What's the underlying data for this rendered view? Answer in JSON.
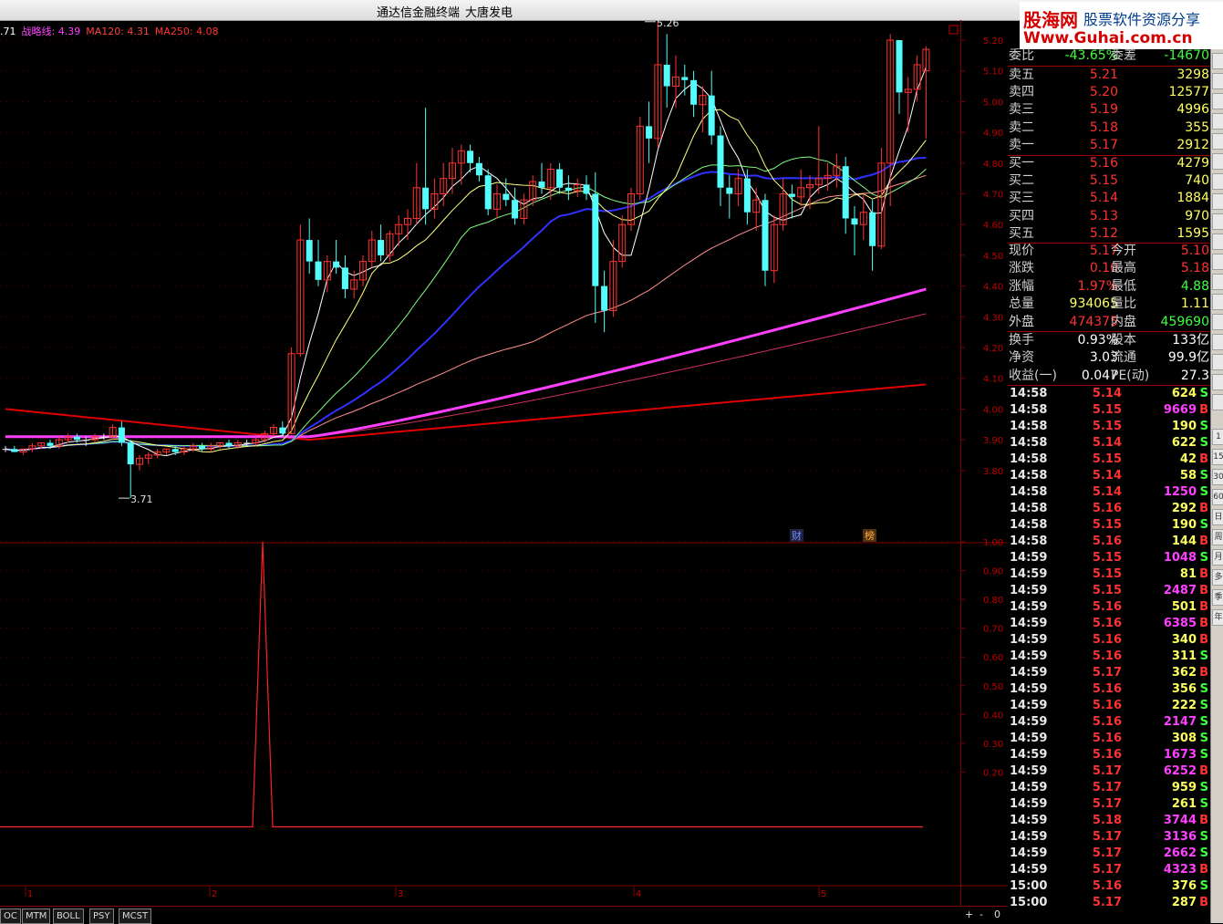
{
  "window": {
    "app_title": "通达信金融终端",
    "stock_name": "大唐发电"
  },
  "logo": {
    "line1": "股海网",
    "line2": "股票软件资源分享",
    "line3": "Www.Guhai.com.cn"
  },
  "indicators": [
    {
      "label": ".71",
      "color": "#ffffff"
    },
    {
      "label": "战略线: 4.39",
      "color": "#ff40ff"
    },
    {
      "label": "MA120: 4.31",
      "color": "#ff4040"
    },
    {
      "label": "MA250: 4.08",
      "color": "#ff3030"
    }
  ],
  "price_axis": [
    "5.20",
    "5.10",
    "5.00",
    "4.90",
    "4.80",
    "4.70",
    "4.60",
    "4.50",
    "4.40",
    "4.30",
    "4.20",
    "4.10",
    "4.00",
    "3.90",
    "3.80"
  ],
  "osc_axis": [
    "1.00",
    "0.90",
    "0.80",
    "0.70",
    "0.60",
    "0.50",
    "0.40",
    "0.30",
    "0.20"
  ],
  "date_axis": [
    "1",
    "2",
    "3",
    "4",
    "5"
  ],
  "annotations": {
    "high": "5.26",
    "low": "3.71",
    "badge1": "财",
    "badge2": "榜"
  },
  "colors": {
    "up": "#ff3232",
    "down": "#54fcfc",
    "even": "#e8e8e8",
    "ma5": "#ffffff",
    "ma10": "#ffff80",
    "ma20": "#80ff80",
    "ma30": "#3030ff",
    "ma60": "#ff9090",
    "strategy": "#ff40ff",
    "ma120": "#ff4040",
    "ma250": "#e00000",
    "grid": "#800000"
  },
  "quote": {
    "weibi_label": "委比",
    "weibi": "-43.65%",
    "weicha_label": "委差",
    "weicha": "-14670",
    "sell": [
      {
        "label": "卖五",
        "price": "5.21",
        "vol": "3298"
      },
      {
        "label": "卖四",
        "price": "5.20",
        "vol": "12577"
      },
      {
        "label": "卖三",
        "price": "5.19",
        "vol": "4996"
      },
      {
        "label": "卖二",
        "price": "5.18",
        "vol": "355"
      },
      {
        "label": "卖一",
        "price": "5.17",
        "vol": "2912"
      }
    ],
    "buy": [
      {
        "label": "买一",
        "price": "5.16",
        "vol": "4279"
      },
      {
        "label": "买二",
        "price": "5.15",
        "vol": "740"
      },
      {
        "label": "买三",
        "price": "5.14",
        "vol": "1884"
      },
      {
        "label": "买四",
        "price": "5.13",
        "vol": "970"
      },
      {
        "label": "买五",
        "price": "5.12",
        "vol": "1595"
      }
    ],
    "stats": [
      {
        "l1": "现价",
        "v1": "5.17",
        "c1": "#ff3232",
        "l2": "今开",
        "v2": "5.10",
        "c2": "#ff3232"
      },
      {
        "l1": "涨跌",
        "v1": "0.10",
        "c1": "#ff3232",
        "l2": "最高",
        "v2": "5.18",
        "c2": "#ff3232"
      },
      {
        "l1": "涨幅",
        "v1": "1.97%",
        "c1": "#ff3232",
        "l2": "最低",
        "v2": "4.88",
        "c2": "#40ff40"
      },
      {
        "l1": "总量",
        "v1": "934065",
        "c1": "#ffff60",
        "l2": "量比",
        "v2": "1.11",
        "c2": "#ffff60"
      },
      {
        "l1": "外盘",
        "v1": "474375",
        "c1": "#ff3232",
        "l2": "内盘",
        "v2": "459690",
        "c2": "#40ff40"
      },
      {
        "l1": "换手",
        "v1": "0.93%",
        "c1": "#ffffff",
        "l2": "股本",
        "v2": "133亿",
        "c2": "#ffffff"
      },
      {
        "l1": "净资",
        "v1": "3.03",
        "c1": "#ffffff",
        "l2": "流通",
        "v2": "99.9亿",
        "c2": "#ffffff"
      },
      {
        "l1": "收益(一)",
        "v1": "0.047",
        "c1": "#ffffff",
        "l2": "PE(动)",
        "v2": "27.3",
        "c2": "#ffffff"
      }
    ]
  },
  "ticks": [
    [
      "14:58",
      "5.14",
      "624",
      "S"
    ],
    [
      "14:58",
      "5.15",
      "9669",
      "B"
    ],
    [
      "14:58",
      "5.15",
      "190",
      "S"
    ],
    [
      "14:58",
      "5.14",
      "622",
      "S"
    ],
    [
      "14:58",
      "5.15",
      "42",
      "B"
    ],
    [
      "14:58",
      "5.14",
      "58",
      "S"
    ],
    [
      "14:58",
      "5.14",
      "1250",
      "S"
    ],
    [
      "14:58",
      "5.16",
      "292",
      "B"
    ],
    [
      "14:58",
      "5.15",
      "190",
      "S"
    ],
    [
      "14:58",
      "5.16",
      "144",
      "B"
    ],
    [
      "14:59",
      "5.15",
      "1048",
      "S"
    ],
    [
      "14:59",
      "5.15",
      "81",
      "B"
    ],
    [
      "14:59",
      "5.15",
      "2487",
      "B"
    ],
    [
      "14:59",
      "5.16",
      "501",
      "B"
    ],
    [
      "14:59",
      "5.16",
      "6385",
      "B"
    ],
    [
      "14:59",
      "5.16",
      "340",
      "B"
    ],
    [
      "14:59",
      "5.16",
      "311",
      "S"
    ],
    [
      "14:59",
      "5.17",
      "362",
      "B"
    ],
    [
      "14:59",
      "5.16",
      "356",
      "S"
    ],
    [
      "14:59",
      "5.16",
      "222",
      "S"
    ],
    [
      "14:59",
      "5.16",
      "2147",
      "S"
    ],
    [
      "14:59",
      "5.16",
      "308",
      "S"
    ],
    [
      "14:59",
      "5.16",
      "1673",
      "S"
    ],
    [
      "14:59",
      "5.17",
      "6252",
      "B"
    ],
    [
      "14:59",
      "5.17",
      "959",
      "S"
    ],
    [
      "14:59",
      "5.17",
      "261",
      "S"
    ],
    [
      "14:59",
      "5.18",
      "3744",
      "B"
    ],
    [
      "14:59",
      "5.17",
      "3136",
      "S"
    ],
    [
      "14:59",
      "5.17",
      "2662",
      "S"
    ],
    [
      "14:59",
      "5.17",
      "4323",
      "B"
    ],
    [
      "15:00",
      "5.16",
      "376",
      "S"
    ],
    [
      "15:00",
      "5.17",
      "287",
      "B"
    ]
  ],
  "bottom_tabs": [
    "OC",
    "MTM",
    "BOLL",
    "PSY",
    "MCST"
  ],
  "bottom_controls": {
    "plus": "+",
    "minus": "-",
    "zero": "0"
  },
  "right_strip": [
    "1",
    "15",
    "30",
    "60",
    "日",
    "周",
    "月",
    "多",
    "季",
    "年"
  ]
}
